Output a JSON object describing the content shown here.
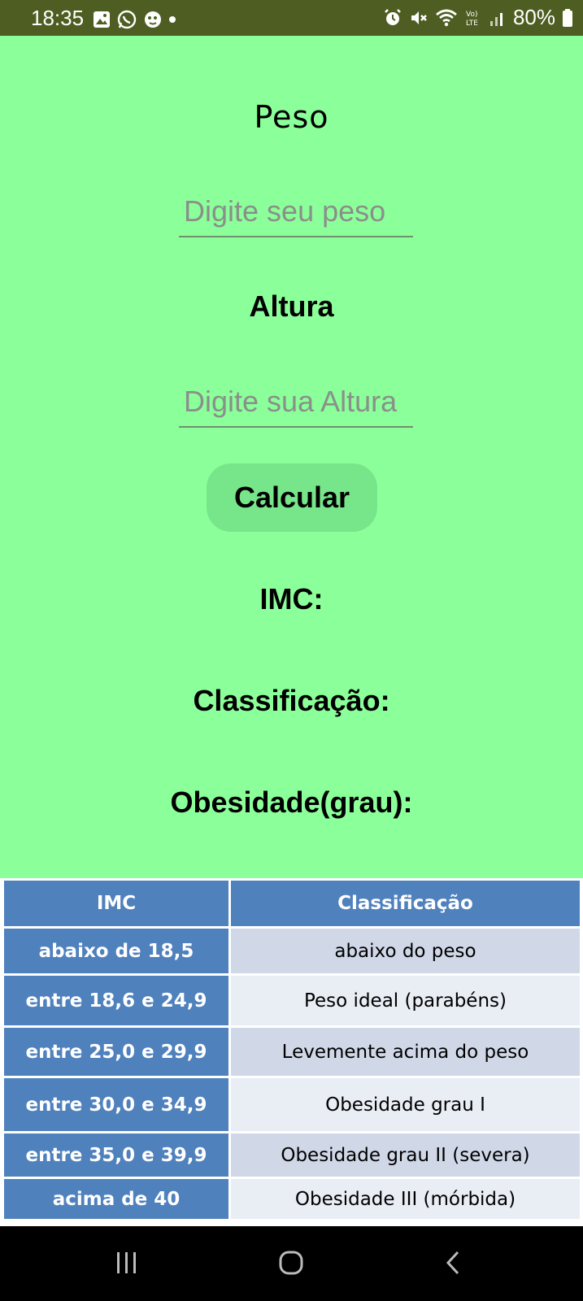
{
  "status_bar": {
    "time": "18:35",
    "battery": "80%"
  },
  "form": {
    "peso_label": "Peso",
    "peso_placeholder": "Digite seu peso",
    "altura_label": "Altura",
    "altura_placeholder": "Digite sua Altura",
    "calc_button": "Calcular"
  },
  "results": {
    "imc_label": "IMC:",
    "classificacao_label": "Classificação:",
    "obesidade_label": "Obesidade(grau):"
  },
  "table": {
    "headers": [
      "IMC",
      "Classificação"
    ],
    "rows": [
      {
        "imc": "abaixo de 18,5",
        "cls": "abaixo do peso"
      },
      {
        "imc": "entre 18,6 e 24,9",
        "cls": "Peso ideal (parabéns)"
      },
      {
        "imc": "entre 25,0 e 29,9",
        "cls": "Levemente acima do peso"
      },
      {
        "imc": "entre 30,0 e 34,9",
        "cls": "Obesidade grau I"
      },
      {
        "imc": "entre 35,0 e 39,9",
        "cls": "Obesidade grau II (severa)"
      },
      {
        "imc": "acima de 40",
        "cls": "Obesidade III (mórbida)"
      }
    ]
  },
  "colors": {
    "background": "#8bff99",
    "status_bar": "#4e5e22",
    "button": "#77e68a",
    "table_header": "#4f81bd"
  }
}
